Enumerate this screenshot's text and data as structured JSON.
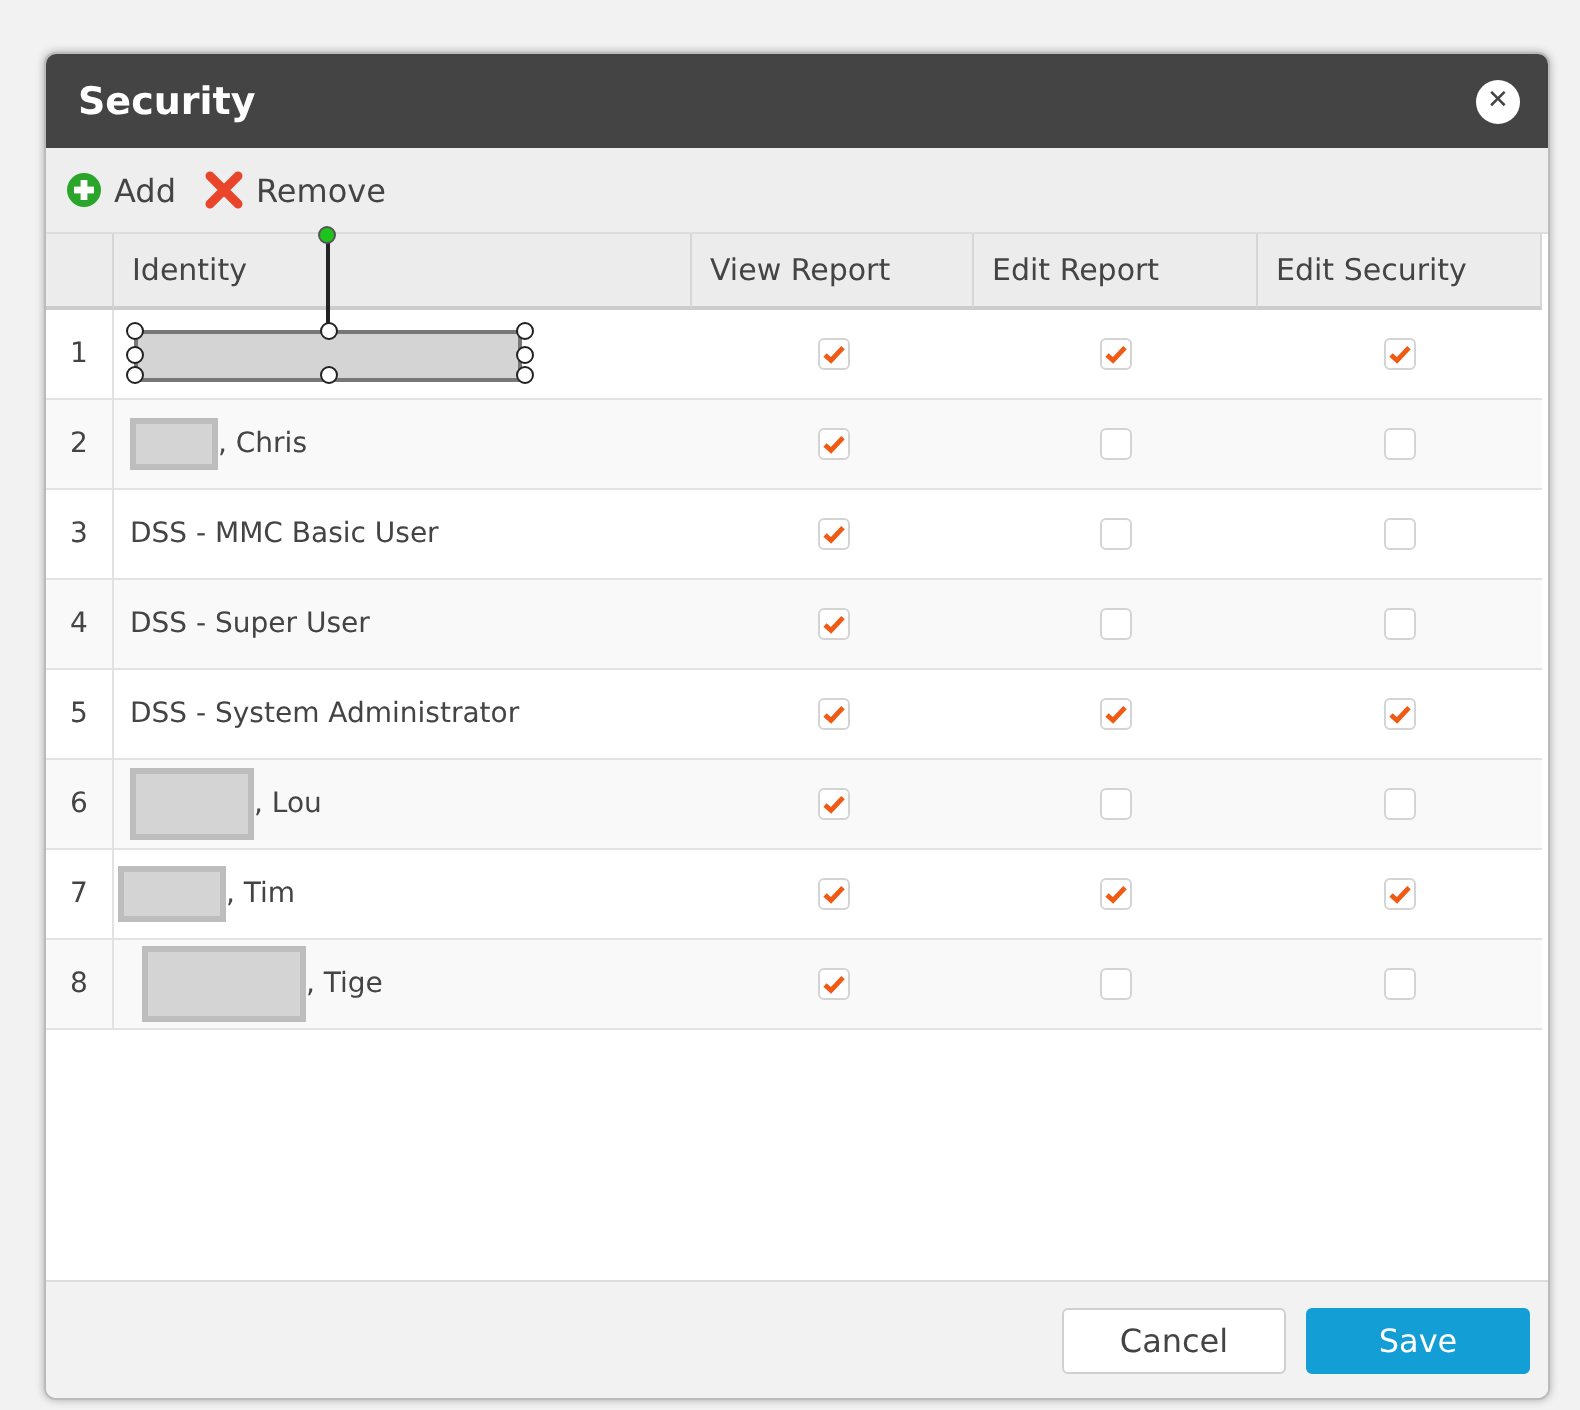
{
  "dialog": {
    "title": "Security",
    "close_icon": "✕"
  },
  "toolbar": [
    {
      "kind": "add",
      "label": "Add"
    },
    {
      "kind": "remove",
      "label": "Remove"
    }
  ],
  "table": {
    "columns": [
      "Identity",
      "View Report",
      "Edit Report",
      "Edit Security"
    ],
    "rows": [
      {
        "number": "1",
        "kind": "redacted_selected",
        "view_report": true,
        "edit_report": true,
        "edit_security": true
      },
      {
        "number": "2",
        "kind": "redacted",
        "name": ", Chris",
        "view_report": true,
        "edit_report": false,
        "edit_security": false
      },
      {
        "number": "3",
        "kind": "plain",
        "name": "DSS - MMC Basic User",
        "view_report": true,
        "edit_report": false,
        "edit_security": false
      },
      {
        "number": "4",
        "kind": "plain",
        "name": "DSS - Super User",
        "view_report": true,
        "edit_report": false,
        "edit_security": false
      },
      {
        "number": "5",
        "kind": "plain",
        "name": "DSS - System Administrator",
        "view_report": true,
        "edit_report": true,
        "edit_security": true
      },
      {
        "number": "6",
        "kind": "redacted",
        "name": ", Lou",
        "view_report": true,
        "edit_report": false,
        "edit_security": false
      },
      {
        "number": "7",
        "kind": "redacted",
        "name": ", Tim",
        "view_report": true,
        "edit_report": true,
        "edit_security": true
      },
      {
        "number": "8",
        "kind": "redacted",
        "name": ", Tige",
        "view_report": true,
        "edit_report": false,
        "edit_security": false
      }
    ]
  },
  "buttons": [
    {
      "kind": "secondary",
      "label": "Cancel"
    },
    {
      "kind": "primary",
      "label": "Save"
    }
  ]
}
